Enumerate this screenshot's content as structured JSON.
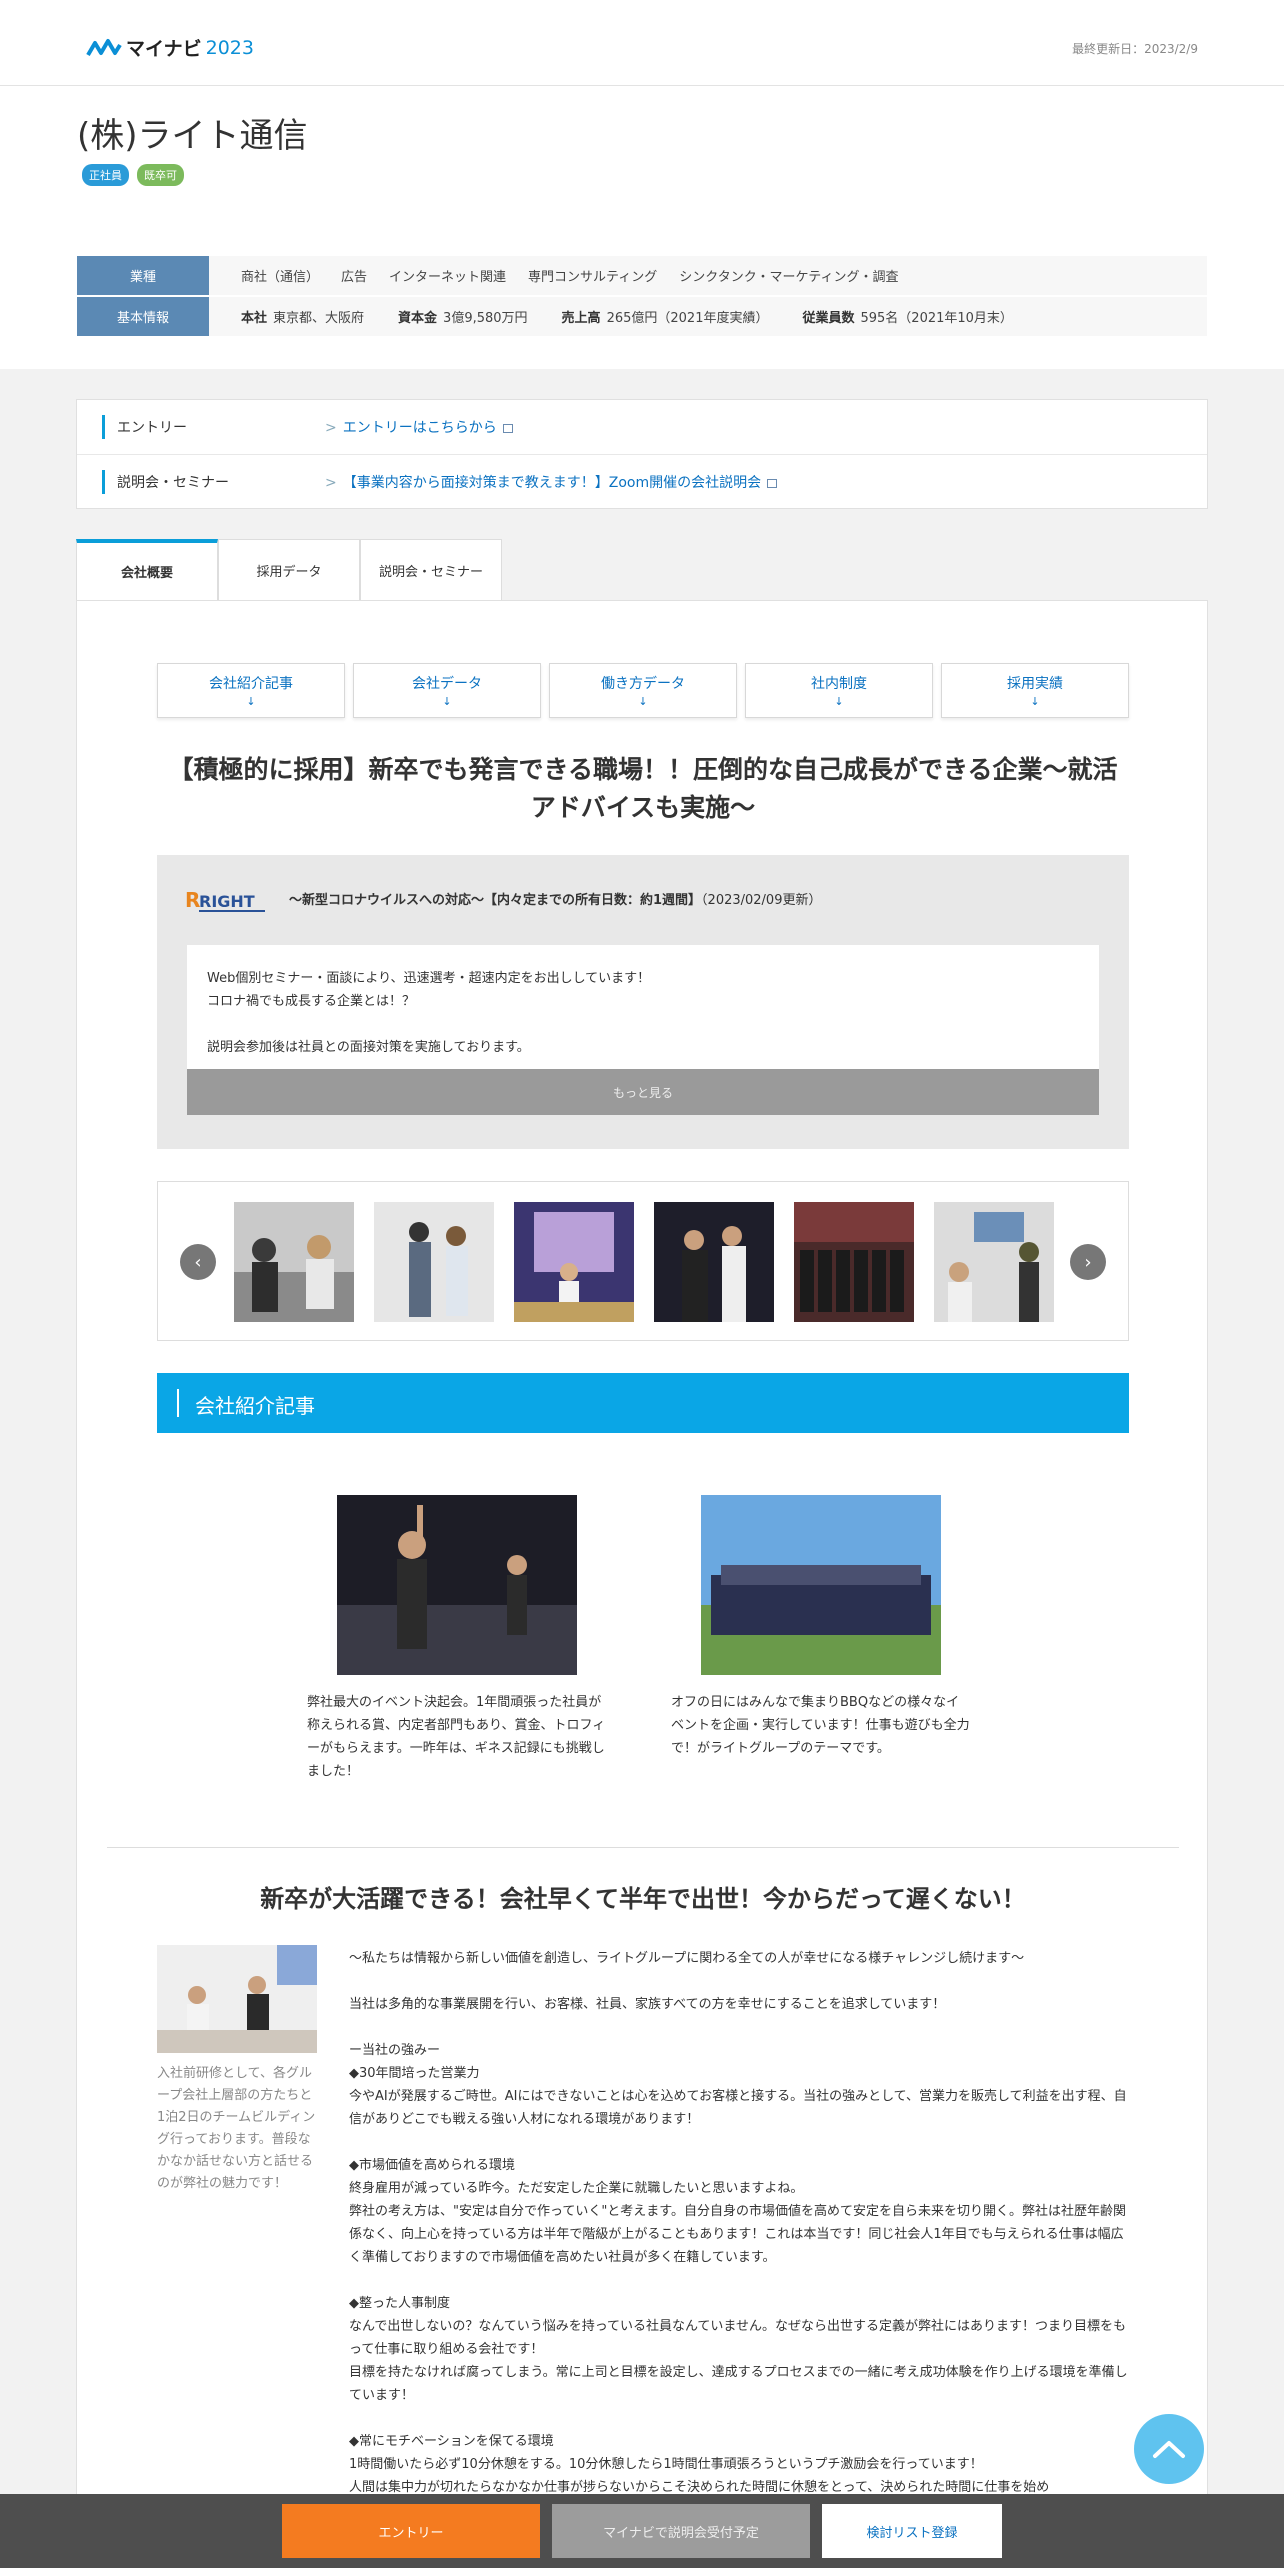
{
  "header": {
    "logo_text": "マイナビ",
    "logo_year": "2023",
    "last_updated": "最終更新日：2023/2/9"
  },
  "company": {
    "name": "(株)ライト通信",
    "tags": [
      "正社員",
      "既卒可"
    ],
    "industry_label": "業種",
    "industries": [
      "商社（通信）",
      "広告",
      "インターネット関連",
      "専門コンサルティング",
      "シンクタンク・マーケティング・調査"
    ],
    "basic_label": "基本情報",
    "basic": [
      {
        "key": "本社",
        "value": "東京都、大阪府"
      },
      {
        "key": "資本金",
        "value": "3億9,580万円"
      },
      {
        "key": "売上高",
        "value": "265億円（2021年度実績）"
      },
      {
        "key": "従業員数",
        "value": "595名（2021年10月末）"
      }
    ]
  },
  "entry_box": {
    "rows": [
      {
        "label": "エントリー",
        "link": "エントリーはこちらから"
      },
      {
        "label": "説明会・セミナー",
        "link": "【事業内容から面接対策まで教えます！】Zoom開催の会社説明会"
      }
    ]
  },
  "tabs": [
    "会社概要",
    "採用データ",
    "説明会・セミナー"
  ],
  "anchors": [
    "会社紹介記事",
    "会社データ",
    "働き方データ",
    "社内制度",
    "採用実績"
  ],
  "anchor_arrow": "↓",
  "headline": "【積極的に採用】新卒でも発言できる職場！！圧倒的な自己成長ができる企業～就活アドバイスも実施～",
  "news": {
    "logo_text": "RIGHT",
    "title_bold": "～新型コロナウイルスへの対応～【内々定までの所有日数：約1週間】",
    "title_date": "（2023/02/09更新）",
    "lines": [
      "Web個別セミナー・面談により、迅速選考・超速内定をお出ししています！",
      "コロナ禍でも成長する企業とは！？",
      "",
      "説明会参加後は社員との面接対策を実施しております。"
    ],
    "more_label": "もっと見る"
  },
  "carousel": {
    "prev": "‹",
    "next": "›"
  },
  "section_title": "会社紹介記事",
  "articles": [
    {
      "text": "弊社最大のイベント決起会。1年間頑張った社員が称えられる賞、内定者部門もあり、賞金、トロフィーがもらえます。一昨年は、ギネス記録にも挑戦しました！"
    },
    {
      "text": "オフの日にはみんなで集まりBBQなどの様々なイベントを企画・実行しています！仕事も遊びも全力で！がライトグループのテーマです。"
    }
  ],
  "sub_headline": "新卒が大活躍できる！会社早くて半年で出世！今からだって遅くない！",
  "side_caption": "入社前研修として、各グループ会社上層部の方たちと1泊2日のチームビルディング行っております。普段なかなか話せない方と話せるのが弊社の魅力です！",
  "body_lines": [
    "～私たちは情報から新しい価値を創造し、ライトグループに関わる全ての人が幸せになる様チャレンジし続けます～",
    "",
    "当社は多角的な事業展開を行い、お客様、社員、家族すべての方を幸せにすることを追求しています！",
    "",
    "ー当社の強みー",
    "◆30年間培った営業力",
    "今やAIが発展するご時世。AIにはできないことは心を込めてお客様と接する。当社の強みとして、営業力を販売して利益を出す程、自信がありどこでも戦える強い人材になれる環境があります！",
    "",
    "◆市場価値を高められる環境",
    "終身雇用が減っている昨今。ただ安定した企業に就職したいと思いますよね。",
    "弊社の考え方は、\"安定は自分で作っていく\"と考えます。自分自身の市場価値を高めて安定を自ら未来を切り開く。弊社は社歴年齢関係なく、向上心を持っている方は半年で階級が上がることもあります！これは本当です！同じ社会人1年目でも与えられる仕事は幅広く準備しておりますので市場価値を高めたい社員が多く在籍しています。",
    "",
    "◆整った人事制度",
    "なんで出世しないの？なんていう悩みを持っている社員なんていません。なぜなら出世する定義が弊社にはあります！つまり目標をもって仕事に取り組める会社です！",
    "目標を持たなければ腐ってしまう。常に上司と目標を設定し、達成するプロセスまでの一緒に考え成功体験を作り上げる環境を準備しています！",
    "",
    "◆常にモチベーションを保てる環境",
    "1時間働いたら必ず10分休憩をする。10分休憩したら1時間仕事頑張ろうというプチ激励会を行っています！",
    "人間は集中力が切れたらなかなか仕事が捗らないからこそ決められた時間に休憩をとって、決められた時間に仕事を始め"
  ],
  "bottom_bar": {
    "entry": "エントリー",
    "seminar": "マイナビで説明会受付予定",
    "list": "検討リスト登録"
  }
}
